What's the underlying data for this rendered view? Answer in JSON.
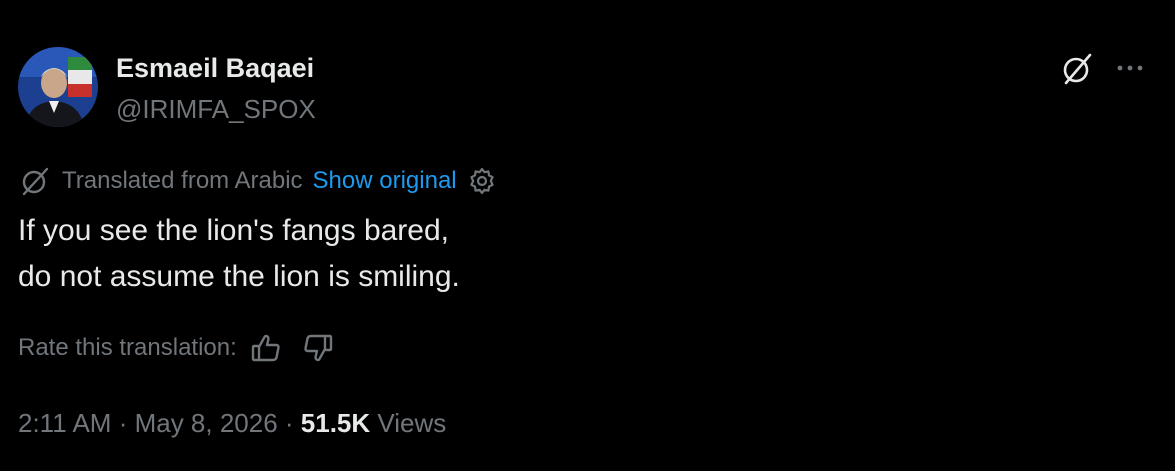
{
  "author": {
    "display_name": "Esmaeil Baqaei",
    "handle": "@IRIMFA_SPOX"
  },
  "header_icons": {
    "grok": "grok-icon",
    "more": "more-icon"
  },
  "translation": {
    "icon": "translate-icon",
    "label": "Translated from Arabic",
    "show_original": "Show original",
    "settings_icon": "gear-icon"
  },
  "tweet": {
    "lines": [
      "If you see the lion's fangs bared,",
      "do not assume the lion is smiling."
    ]
  },
  "rating": {
    "label": "Rate this translation:",
    "up_icon": "thumbs-up-icon",
    "down_icon": "thumbs-down-icon"
  },
  "meta": {
    "time": "2:11 AM",
    "separator": " · ",
    "date": "May 8, 2026",
    "views_count": "51.5K",
    "views_label": "Views"
  },
  "colors": {
    "background": "#000000",
    "primary_text": "#e7e9ea",
    "secondary_text": "#71767b",
    "link": "#1d9bf0"
  }
}
